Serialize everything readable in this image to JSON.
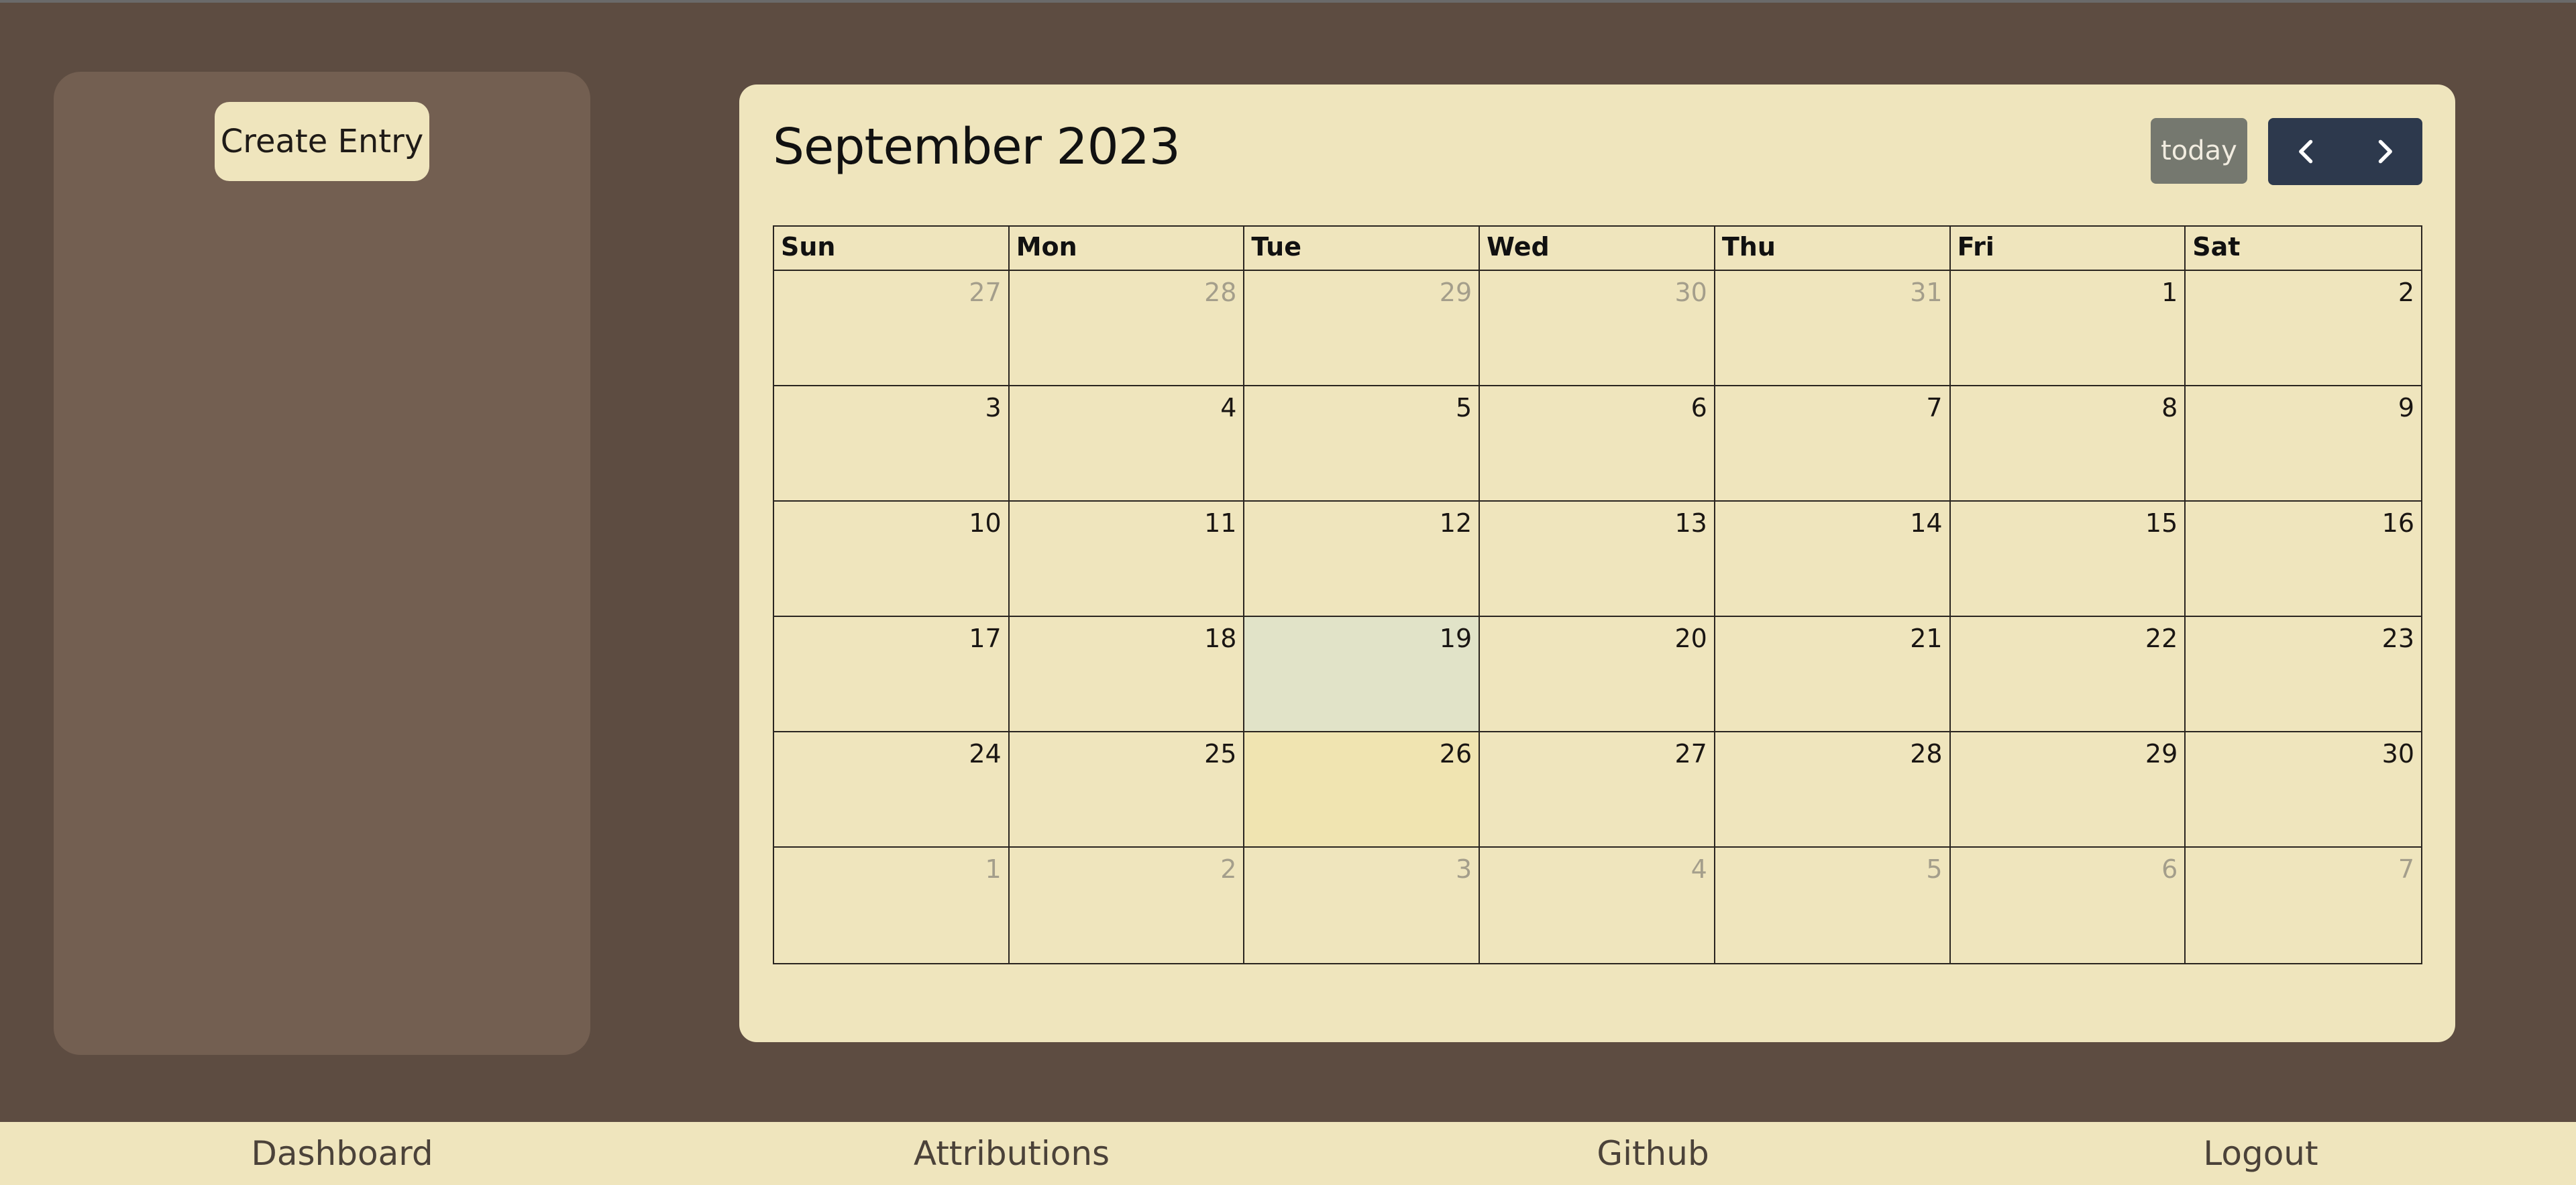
{
  "sidebar": {
    "create_label": "Create Entry"
  },
  "calendar": {
    "title": "September 2023",
    "today_label": "today",
    "prev_icon": "chevron-left-icon",
    "next_icon": "chevron-right-icon",
    "weekdays": [
      "Sun",
      "Mon",
      "Tue",
      "Wed",
      "Thu",
      "Fri",
      "Sat"
    ],
    "weeks": [
      [
        {
          "d": "27",
          "other": true
        },
        {
          "d": "28",
          "other": true
        },
        {
          "d": "29",
          "other": true
        },
        {
          "d": "30",
          "other": true
        },
        {
          "d": "31",
          "other": true
        },
        {
          "d": "1"
        },
        {
          "d": "2"
        }
      ],
      [
        {
          "d": "3"
        },
        {
          "d": "4"
        },
        {
          "d": "5"
        },
        {
          "d": "6"
        },
        {
          "d": "7"
        },
        {
          "d": "8"
        },
        {
          "d": "9"
        }
      ],
      [
        {
          "d": "10"
        },
        {
          "d": "11"
        },
        {
          "d": "12"
        },
        {
          "d": "13"
        },
        {
          "d": "14"
        },
        {
          "d": "15"
        },
        {
          "d": "16"
        }
      ],
      [
        {
          "d": "17"
        },
        {
          "d": "18"
        },
        {
          "d": "19",
          "state": "today"
        },
        {
          "d": "20"
        },
        {
          "d": "21"
        },
        {
          "d": "22"
        },
        {
          "d": "23"
        }
      ],
      [
        {
          "d": "24"
        },
        {
          "d": "25"
        },
        {
          "d": "26",
          "state": "highlighted"
        },
        {
          "d": "27"
        },
        {
          "d": "28"
        },
        {
          "d": "29"
        },
        {
          "d": "30"
        }
      ],
      [
        {
          "d": "1",
          "other": true
        },
        {
          "d": "2",
          "other": true
        },
        {
          "d": "3",
          "other": true
        },
        {
          "d": "4",
          "other": true
        },
        {
          "d": "5",
          "other": true
        },
        {
          "d": "6",
          "other": true
        },
        {
          "d": "7",
          "other": true
        }
      ]
    ]
  },
  "footer": {
    "links": [
      "Dashboard",
      "Attributions",
      "Github",
      "Logout"
    ]
  },
  "colors": {
    "background": "#5d4c41",
    "sidebar": "#735f51",
    "cream": "#efe5bd",
    "today_cell": "#e1e3c8",
    "highlight_cell": "#f0e4b1",
    "nav_button": "#2d394d",
    "today_button": "#75786f"
  }
}
